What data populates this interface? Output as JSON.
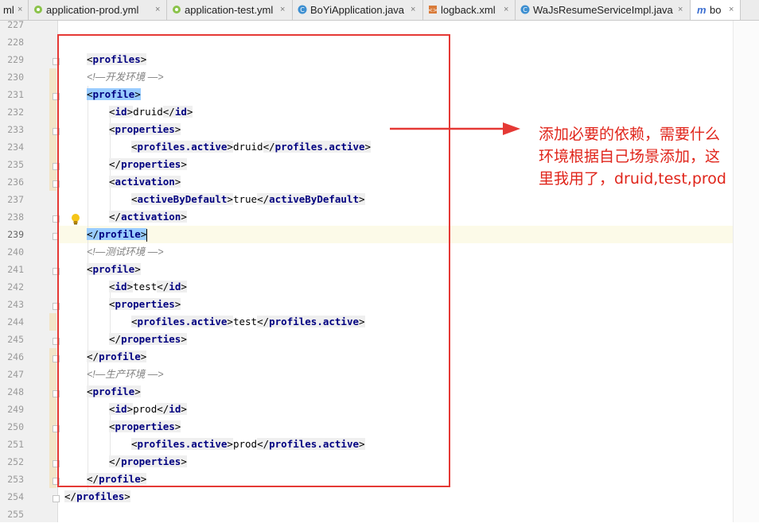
{
  "tabs": [
    {
      "label": "ml",
      "icon": "file-icon",
      "close": "×"
    },
    {
      "label": "application-prod.yml",
      "icon": "yaml-icon",
      "close": "×"
    },
    {
      "label": "application-test.yml",
      "icon": "yaml-icon",
      "close": "×"
    },
    {
      "label": "BoYiApplication.java",
      "icon": "java-class-icon",
      "close": "×"
    },
    {
      "label": "logback.xml",
      "icon": "xml-icon",
      "close": "×"
    },
    {
      "label": "WaJsResumeServiceImpl.java",
      "icon": "java-class-icon",
      "close": "×"
    },
    {
      "label": "bo",
      "icon": "maven-icon",
      "prefix": "m",
      "close": "×"
    }
  ],
  "line_numbers": [
    "227",
    "228",
    "229",
    "230",
    "231",
    "232",
    "233",
    "234",
    "235",
    "236",
    "237",
    "238",
    "239",
    "240",
    "241",
    "242",
    "243",
    "244",
    "245",
    "246",
    "247",
    "248",
    "249",
    "250",
    "251",
    "252",
    "253",
    "254",
    "255"
  ],
  "current_line": "239",
  "code": {
    "profiles_open": "profiles",
    "comment_dev": "<!—开发环境 —>",
    "comment_test": "<!—测试环境 —>",
    "comment_prod": "<!—生产环境 —>",
    "profile": "profile",
    "id": "id",
    "properties": "properties",
    "profiles_active": "profiles.active",
    "activation": "activation",
    "activeByDefault": "activeByDefault",
    "val_druid": "druid",
    "val_test": "test",
    "val_prod": "prod",
    "val_true": "true"
  },
  "annotation": {
    "text_line1": "添加必要的依赖，需要什么",
    "text_line2": "环境根据自己场景添加，这",
    "text_line3": "里我用了，druid,test,prod",
    "color": "#e0251b"
  },
  "colors": {
    "tag": "#000080",
    "comment": "#808080",
    "current_line_bg": "#fcfae8",
    "annotation_red": "#e53935"
  }
}
